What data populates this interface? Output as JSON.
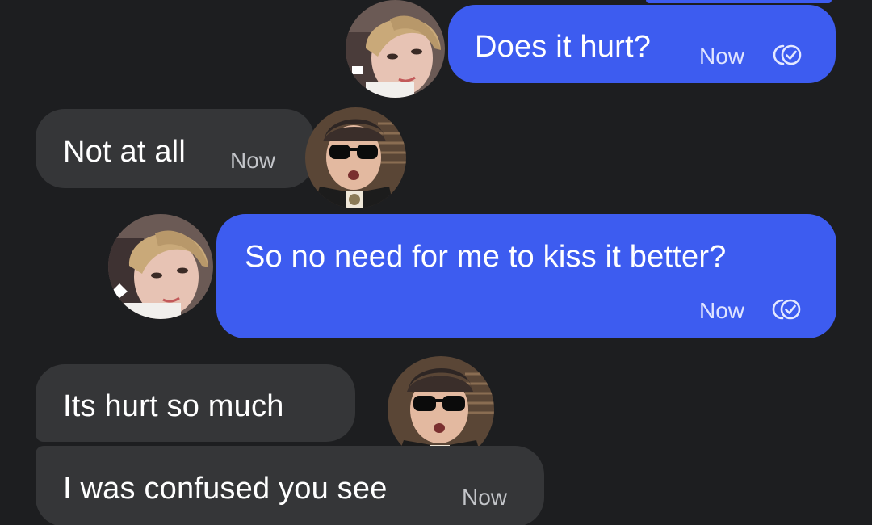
{
  "conversation": {
    "messages": [
      {
        "direction": "sent",
        "text": "Does it hurt?",
        "time": "Now",
        "status_icon": "double-check-icon",
        "avatar": "sender-avatar-blonde"
      },
      {
        "direction": "received",
        "text": "Not at all",
        "time": "Now",
        "avatar": "contact-avatar-sunglasses"
      },
      {
        "direction": "sent",
        "text": "So no need for me to kiss it better?",
        "time": "Now",
        "status_icon": "double-check-icon",
        "avatar": "sender-avatar-blonde"
      },
      {
        "direction": "received",
        "text": "Its hurt so much",
        "avatar": "contact-avatar-sunglasses"
      },
      {
        "direction": "received",
        "text": "I was confused you see",
        "time": "Now"
      }
    ]
  },
  "colors": {
    "background": "#1d1e20",
    "sent_bubble": "#3d5cf0",
    "received_bubble": "#353638",
    "text": "#ffffff"
  }
}
